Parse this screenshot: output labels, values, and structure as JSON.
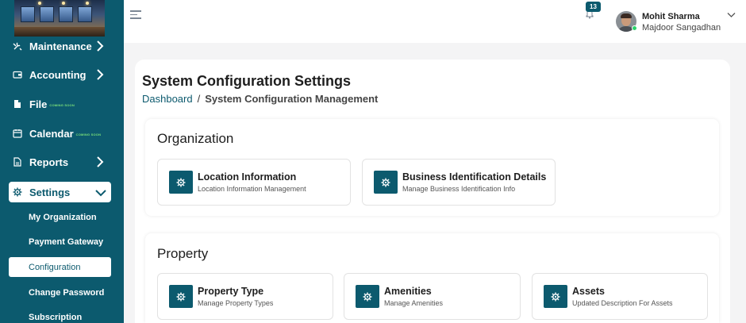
{
  "colors": {
    "primary": "#0c5a6e",
    "active_bg": "#ffffff",
    "online": "#2bd36b",
    "soon": "#7ae07a"
  },
  "sidebar": {
    "items": [
      {
        "label": "Maintenance",
        "icon": "tools-icon",
        "chevron": "right"
      },
      {
        "label": "Accounting",
        "icon": "wallet-icon",
        "chevron": "right"
      },
      {
        "label": "File",
        "icon": "file-icon",
        "badge": "COMING SOON"
      },
      {
        "label": "Calendar",
        "icon": "calendar-icon",
        "badge": "COMING SOON"
      },
      {
        "label": "Reports",
        "icon": "document-icon",
        "chevron": "right"
      },
      {
        "label": "Settings",
        "icon": "gear-icon",
        "chevron": "down",
        "active": true
      }
    ],
    "sub_items": [
      {
        "label": "My Organization"
      },
      {
        "label": "Payment Gateway"
      },
      {
        "label": "Configuration",
        "active": true
      },
      {
        "label": "Change Password"
      },
      {
        "label": "Subscription"
      }
    ]
  },
  "header": {
    "notifications_count": "13",
    "user": {
      "name": "Mohit Sharma",
      "organization": "Majdoor Sangadhan"
    }
  },
  "main": {
    "title": "System Configuration Settings",
    "breadcrumb": {
      "link": "Dashboard",
      "separator": "/",
      "current": "System Configuration Management"
    },
    "sections": [
      {
        "title": "Organization",
        "tiles": [
          {
            "title": "Location Information",
            "description": "Location Information Management",
            "icon": "gear-icon"
          },
          {
            "title": "Business Identification Details",
            "description": "Manage Business Identification Info",
            "icon": "gear-icon"
          }
        ]
      },
      {
        "title": "Property",
        "tiles": [
          {
            "title": "Property Type",
            "description": "Manage Property Types",
            "icon": "gear-icon"
          },
          {
            "title": "Amenities",
            "description": "Manage Amenities",
            "icon": "gear-icon"
          },
          {
            "title": "Assets",
            "description": "Updated Description For Assets",
            "icon": "gear-icon"
          }
        ]
      }
    ]
  }
}
